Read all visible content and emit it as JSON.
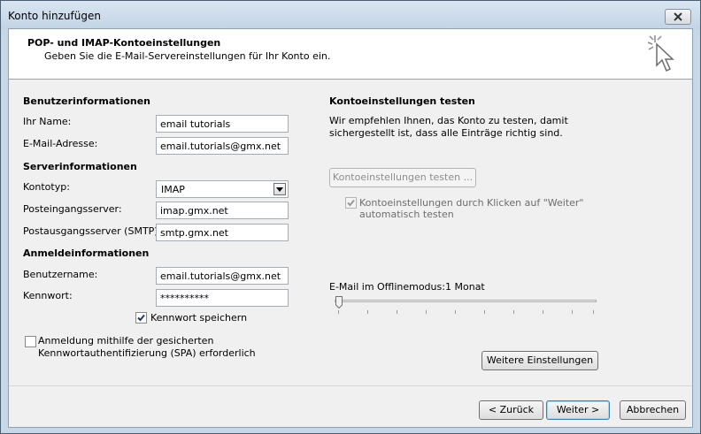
{
  "window": {
    "title": "Konto hinzufügen"
  },
  "header": {
    "title": "POP- und IMAP-Kontoeinstellungen",
    "subtitle": "Geben Sie die E-Mail-Servereinstellungen für Ihr Konto ein."
  },
  "user_info": {
    "heading": "Benutzerinformationen",
    "name_label": "Ihr Name:",
    "name_value": "email tutorials",
    "email_label": "E-Mail-Adresse:",
    "email_value": "email.tutorials@gmx.net"
  },
  "server_info": {
    "heading": "Serverinformationen",
    "type_label": "Kontotyp:",
    "type_value": "IMAP",
    "incoming_label": "Posteingangsserver:",
    "incoming_value": "imap.gmx.net",
    "outgoing_label": "Postausgangsserver (SMTP):",
    "outgoing_value": "smtp.gmx.net"
  },
  "login_info": {
    "heading": "Anmeldeinformationen",
    "username_label": "Benutzername:",
    "username_value": "email.tutorials@gmx.net",
    "password_label": "Kennwort:",
    "password_value": "**********",
    "remember_label": "Kennwort speichern",
    "remember_checked": true,
    "spa_label_1": "Anmeldung mithilfe der gesicherten",
    "spa_label_2": "Kennwortauthentifizierung (SPA) erforderlich",
    "spa_checked": false
  },
  "test": {
    "heading": "Kontoeinstellungen testen",
    "desc_1": "Wir empfehlen Ihnen, das Konto zu testen, damit",
    "desc_2": "sichergestellt ist, dass alle Einträge richtig sind.",
    "test_button": "Kontoeinstellungen testen ...",
    "auto_label_1": "Kontoeinstellungen durch Klicken auf \"Weiter\"",
    "auto_label_2": "automatisch testen",
    "auto_checked": true
  },
  "offline": {
    "label": "E-Mail im Offlinemodus:",
    "value": "1 Monat",
    "slider_position": 0
  },
  "buttons": {
    "more_settings": "Weitere Einstellungen",
    "back": "< Zurück",
    "next": "Weiter >",
    "cancel": "Abbrechen"
  }
}
